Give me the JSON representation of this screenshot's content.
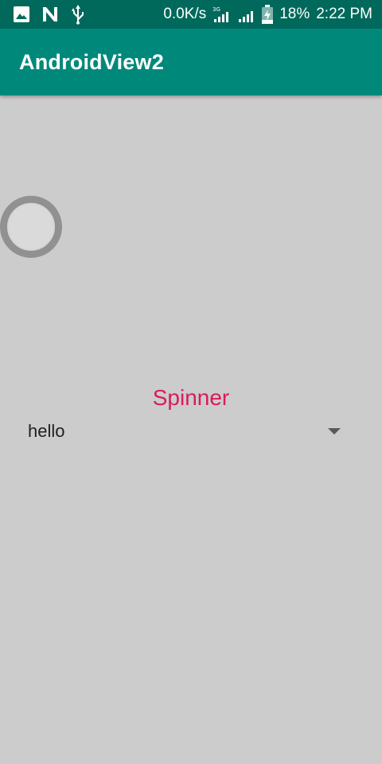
{
  "status_bar": {
    "icons_left": [
      "image-icon",
      "n-notification-icon",
      "usb-icon"
    ],
    "net_speed": "0.0K/s",
    "network_type": "3G",
    "battery_percent": "18%",
    "time": "2:22 PM"
  },
  "app_bar": {
    "title": "AndroidView2"
  },
  "main": {
    "progress_indicator": "circular-progress",
    "spinner_title": "Spinner",
    "spinner_selected": "hello"
  },
  "colors": {
    "status_bar": "#00695c",
    "app_bar": "#00897b",
    "background": "#cccccc",
    "accent": "#d81b60"
  }
}
